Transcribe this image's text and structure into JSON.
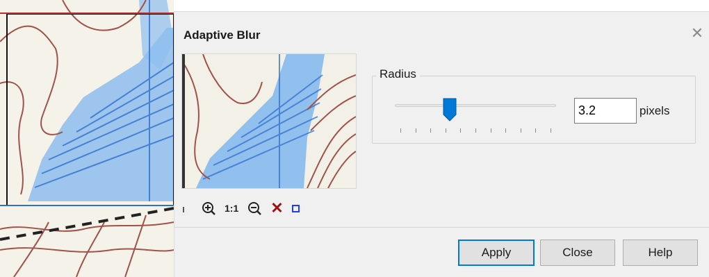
{
  "dialog": {
    "title": "Adaptive Blur",
    "close_icon": "close-icon"
  },
  "preview_tools": [
    {
      "name": "preview-marker",
      "icon": "tick-icon"
    },
    {
      "name": "zoom-in-button",
      "icon": "zoom-in-icon"
    },
    {
      "name": "actual-size-button",
      "label": "1:1"
    },
    {
      "name": "zoom-out-button",
      "icon": "zoom-out-icon"
    },
    {
      "name": "cancel-preview-button",
      "icon": "x-icon",
      "color": "#a01010"
    },
    {
      "name": "preview-frame-button",
      "icon": "square-icon",
      "color": "#1e3cff"
    }
  ],
  "radius": {
    "group_label": "Radius",
    "value": "3.2",
    "unit": "pixels",
    "slider_fraction": 0.33,
    "tick_count": 11
  },
  "buttons": {
    "apply": "Apply",
    "close": "Close",
    "help": "Help"
  },
  "colors": {
    "accent": "#0078d7",
    "dialog_bg": "#f0f0f0",
    "map_water": "#5aa0e6",
    "contour": "#a0524a"
  }
}
